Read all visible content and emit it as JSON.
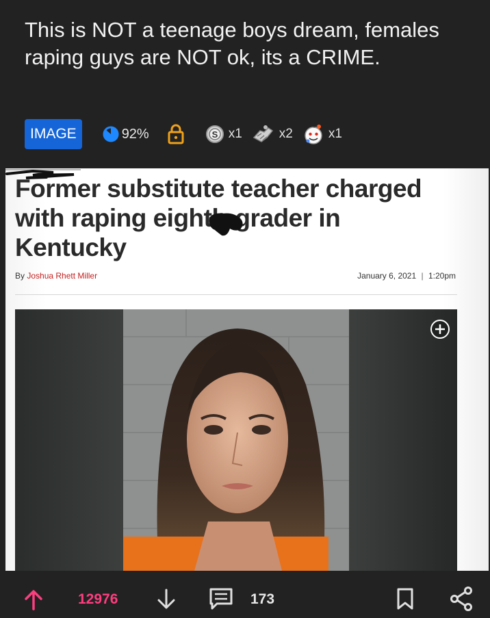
{
  "post": {
    "title": "This is NOT a teenage boys dream, females raping guys are NOT ok, its a CRIME.",
    "type_badge": "IMAGE",
    "upvote_ratio": "92%",
    "awards": [
      {
        "icon": "silver-award-icon",
        "count": "x1"
      },
      {
        "icon": "helpful-hands-award-icon",
        "count": "x2"
      },
      {
        "icon": "wholesome-award-icon",
        "count": "x1"
      }
    ]
  },
  "article": {
    "headline": "Former substitute teacher charged with raping eighth-grader in Kentucky",
    "byline_prefix": "By",
    "author": "Joshua Rhett Miller",
    "date": "January 6, 2021",
    "separator": "|",
    "time": "1:20pm"
  },
  "actions": {
    "score": "12976",
    "comments": "173"
  },
  "colors": {
    "background": "#222223",
    "badge": "#1565d8",
    "upvoted": "#ff3d7f",
    "lock": "#f0a21a"
  }
}
